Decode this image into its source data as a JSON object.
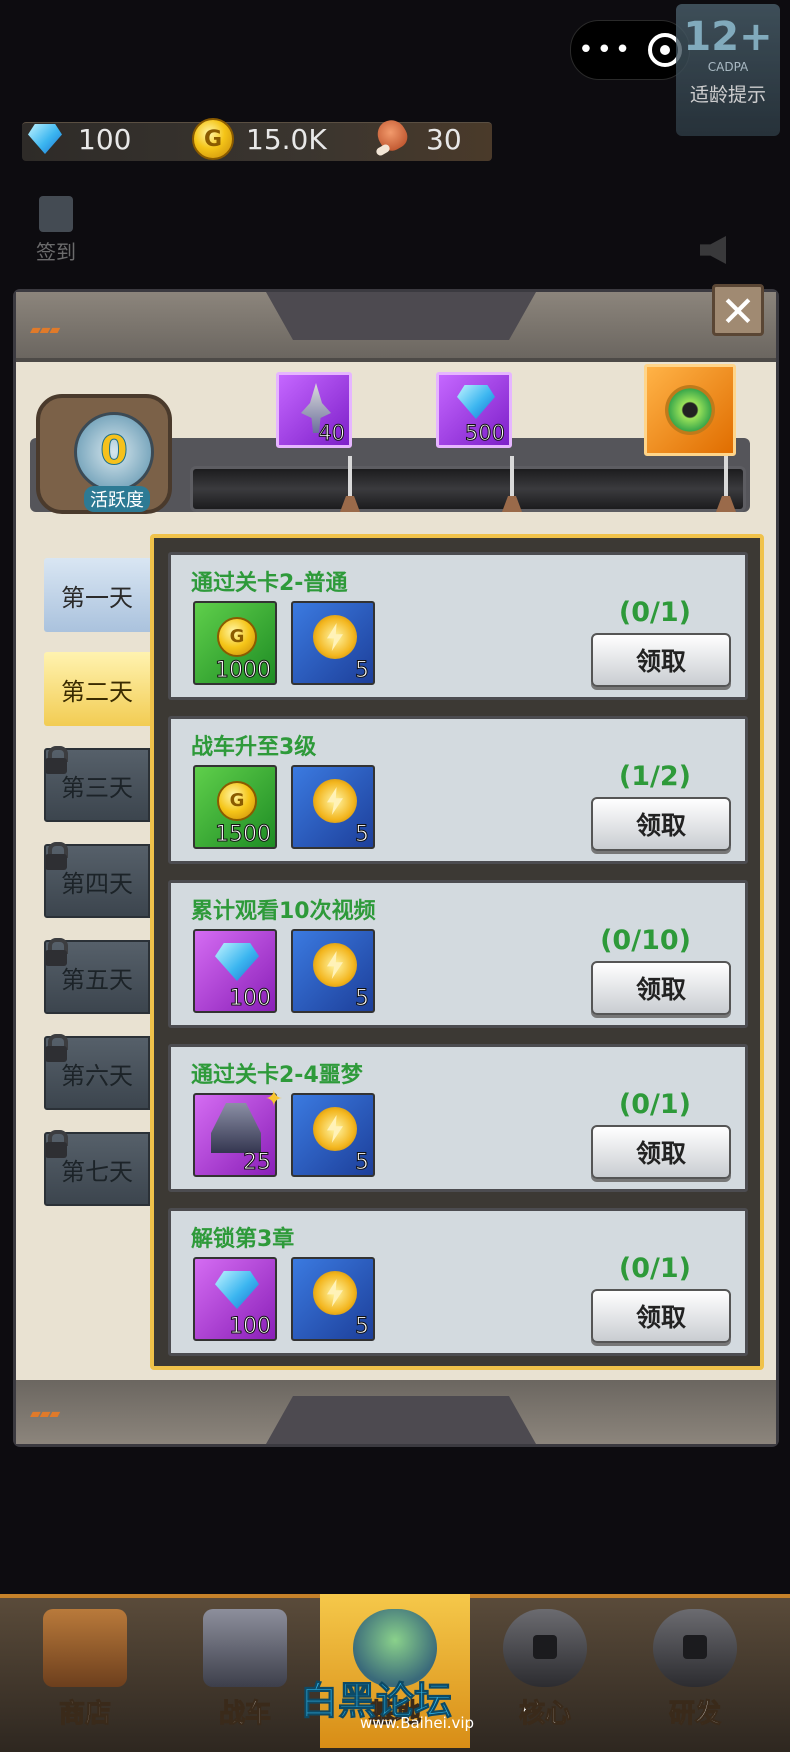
{
  "resources": {
    "gems": "100",
    "coins": "15.0K",
    "meat": "30"
  },
  "rating_badge": {
    "big": "12+",
    "org": "CADPA",
    "label": "适龄提示"
  },
  "side_buttons": {
    "signin": "签到"
  },
  "activity": {
    "points": "0",
    "label": "活跃度",
    "milestones": [
      {
        "reward": "mech",
        "amount": "40"
      },
      {
        "reward": "gem",
        "amount": "500"
      },
      {
        "reward": "chest",
        "amount": ""
      }
    ]
  },
  "days": [
    {
      "label": "第一天",
      "state": "done"
    },
    {
      "label": "第二天",
      "state": "active"
    },
    {
      "label": "第三天",
      "state": "locked"
    },
    {
      "label": "第四天",
      "state": "locked"
    },
    {
      "label": "第五天",
      "state": "locked"
    },
    {
      "label": "第六天",
      "state": "locked"
    },
    {
      "label": "第七天",
      "state": "locked"
    }
  ],
  "tasks": [
    {
      "title": "通过关卡2-普通",
      "progress": "(0/1)",
      "claim": "领取",
      "rewards": [
        {
          "icon": "coin-icon",
          "amount": "1000"
        },
        {
          "icon": "activity-xp-icon",
          "amount": "5"
        }
      ]
    },
    {
      "title": "战车升至3级",
      "progress": "(1/2)",
      "claim": "领取",
      "rewards": [
        {
          "icon": "coin-icon",
          "amount": "1500"
        },
        {
          "icon": "activity-xp-icon",
          "amount": "5"
        }
      ]
    },
    {
      "title": "累计观看10次视频",
      "progress": "(0/10)",
      "claim": "领取",
      "rewards": [
        {
          "icon": "gem-icon",
          "amount": "100"
        },
        {
          "icon": "activity-xp-icon",
          "amount": "5"
        }
      ]
    },
    {
      "title": "通过关卡2-4噩梦",
      "progress": "(0/1)",
      "claim": "领取",
      "rewards": [
        {
          "icon": "tank-icon",
          "amount": "25"
        },
        {
          "icon": "activity-xp-icon",
          "amount": "5"
        }
      ]
    },
    {
      "title": "解锁第3章",
      "progress": "(0/1)",
      "claim": "领取",
      "rewards": [
        {
          "icon": "gem-icon",
          "amount": "100"
        },
        {
          "icon": "activity-xp-icon",
          "amount": "5"
        }
      ]
    }
  ],
  "nav": [
    {
      "label": "商店",
      "icon": "shop-icon"
    },
    {
      "label": "战车",
      "icon": "tank-icon"
    },
    {
      "label": "基地",
      "icon": "base-icon"
    },
    {
      "label": "核心",
      "icon": "core-icon"
    },
    {
      "label": "研发",
      "icon": "research-icon"
    }
  ],
  "watermark": {
    "name": "白黑论坛",
    "url": "www.Baihei.vip"
  },
  "colors": {
    "task_green": "#2e9a3a",
    "frame_gold": "#f0c24a",
    "active_day": "#f2cc53"
  }
}
